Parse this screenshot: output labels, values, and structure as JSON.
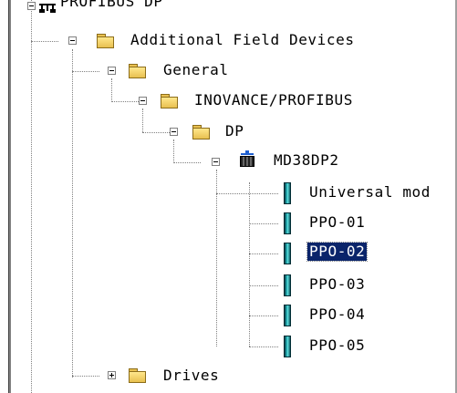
{
  "tree": {
    "root": {
      "label": "PROFIBUS DP"
    },
    "additional": {
      "label": "Additional Field Devices"
    },
    "general": {
      "label": "General"
    },
    "inovance": {
      "label": "INOVANCE/PROFIBUS"
    },
    "dp": {
      "label": "DP"
    },
    "device": {
      "label": "MD38DP2"
    },
    "modules": [
      {
        "label": "Universal mod"
      },
      {
        "label": "PPO-01"
      },
      {
        "label": "PPO-02"
      },
      {
        "label": "PPO-03"
      },
      {
        "label": "PPO-04"
      },
      {
        "label": "PPO-05"
      }
    ],
    "drives": {
      "label": "Drives"
    },
    "selected_module": "PPO-02"
  },
  "colors": {
    "selection_bg": "#0a246a",
    "selection_text": "#ffffff",
    "folder": "#e8c050",
    "module_icon": "#1aa3a8"
  }
}
